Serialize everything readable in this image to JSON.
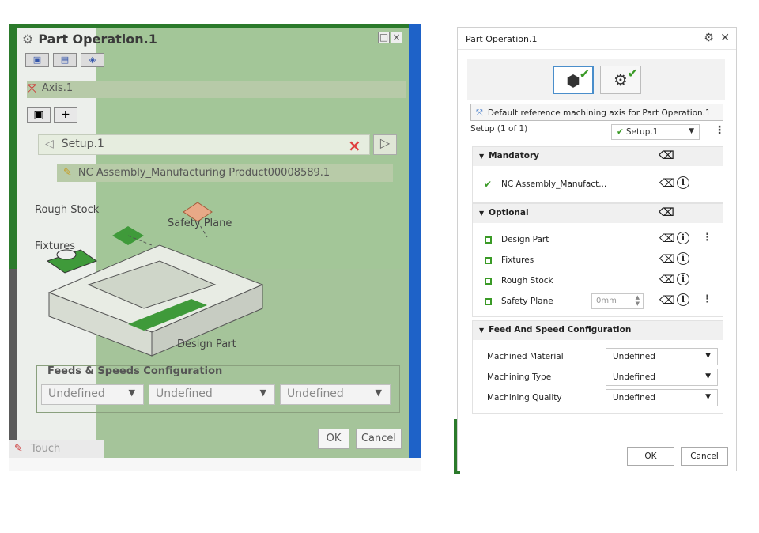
{
  "left_dialog": {
    "title": "Part Operation.1",
    "axis_label": "Axis.1",
    "setup_value": "Setup.1",
    "nc_assembly": "NC Assembly_Manufacturing Product00008589.1",
    "rough_stock_label": "Rough Stock",
    "fixtures_label": "Fixtures",
    "safety_plane_label": "Safety Plane",
    "design_part_label": "Design Part",
    "feeds_speeds_title": "Feeds & Speeds Configuration",
    "selects": [
      "Undefined",
      "Undefined",
      "Undefined"
    ],
    "ok_label": "OK",
    "cancel_label": "Cancel",
    "touch_label": "Touch"
  },
  "right_dialog": {
    "title": "Part Operation.1",
    "axis_text": "Default reference machining axis for Part Operation.1",
    "setup_label": "Setup (1 of 1)",
    "setup_value": "Setup.1",
    "mandatory": {
      "title": "Mandatory",
      "items": [
        {
          "label": "NC Assembly_Manufact..."
        }
      ]
    },
    "optional": {
      "title": "Optional",
      "items": [
        {
          "label": "Design Part"
        },
        {
          "label": "Fixtures"
        },
        {
          "label": "Rough Stock"
        },
        {
          "label": "Safety Plane",
          "value": "0mm"
        }
      ]
    },
    "feed_speed": {
      "title": "Feed And Speed Configuration",
      "rows": [
        {
          "label": "Machined Material",
          "value": "Undefined"
        },
        {
          "label": "Machining Type",
          "value": "Undefined"
        },
        {
          "label": "Machining Quality",
          "value": "Undefined"
        }
      ]
    },
    "ok_label": "OK",
    "cancel_label": "Cancel"
  },
  "colors": {
    "accent_green": "#3a9a26",
    "selection_blue": "#4a8ecb",
    "legacy_green": "#a9c99d"
  }
}
